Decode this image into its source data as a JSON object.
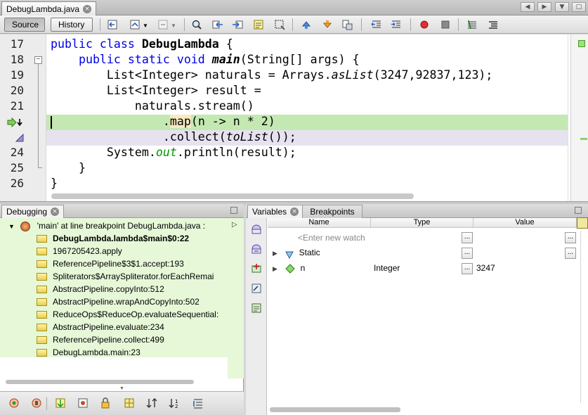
{
  "editor_tab": {
    "title": "DebugLambda.java",
    "close": "⊗"
  },
  "toolbar": {
    "source_label": "Source",
    "history_label": "History"
  },
  "code": {
    "lines": [
      {
        "num": "17"
      },
      {
        "num": "18"
      },
      {
        "num": "19"
      },
      {
        "num": "20"
      },
      {
        "num": "21"
      },
      {
        "num": ""
      },
      {
        "num": ""
      },
      {
        "num": "24"
      },
      {
        "num": "25"
      },
      {
        "num": "26"
      }
    ],
    "t": {
      "l17a": "public class ",
      "l17b": "DebugLambda",
      "l17c": " {",
      "l18a": "    public static void ",
      "l18b": "main",
      "l18c": "(String[] args) {",
      "l19a": "        List<Integer> naturals = Arrays.",
      "l19b": "asList",
      "l19c": "(3247,92837,123);",
      "l20": "        List<Integer> result =",
      "l21": "            naturals.stream()",
      "l22a": "                .",
      "l22b": "map",
      "l22c": "(n -> n * 2)",
      "l23a": "                .collect(",
      "l23b": "toList",
      "l23c": "());",
      "l24a": "        System.",
      "l24b": "out",
      "l24c": ".println(result);",
      "l25": "    }",
      "l26": "}"
    }
  },
  "debugging": {
    "tab_label": "Debugging",
    "thread": "'main' at line breakpoint DebugLambda.java :",
    "frames": [
      "DebugLambda.lambda$main$0:22",
      "1967205423.apply",
      "ReferencePipeline$3$1.accept:193",
      "Spliterators$ArraySpliterator.forEachRemai",
      "AbstractPipeline.copyInto:512",
      "AbstractPipeline.wrapAndCopyInto:502",
      "ReduceOps$ReduceOp.evaluateSequential:",
      "AbstractPipeline.evaluate:234",
      "ReferencePipeline.collect:499",
      "DebugLambda.main:23"
    ]
  },
  "variables": {
    "tab_label": "Variables",
    "breakpoints_label": "Breakpoints",
    "columns": {
      "name": "Name",
      "type": "Type",
      "value": "Value"
    },
    "watch_placeholder": "<Enter new watch",
    "static_label": "Static",
    "var_name": "n",
    "var_type": "Integer",
    "var_value": "3247",
    "dots": "..."
  },
  "colors": {
    "highlight_green": "#c4e8b2",
    "highlight_purple": "#e6e2f0",
    "panel_green": "#e6f8d8"
  }
}
